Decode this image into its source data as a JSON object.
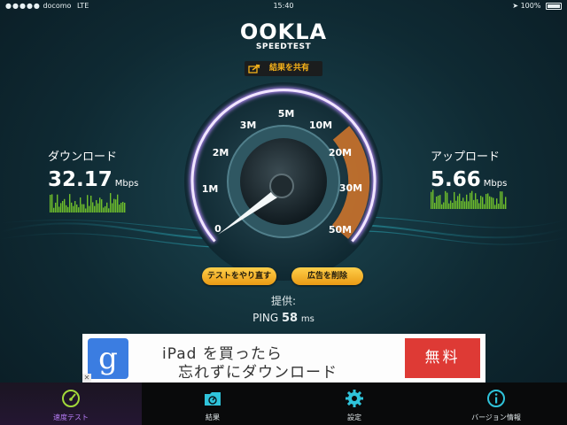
{
  "status_bar": {
    "carrier": "docomo",
    "network": "LTE",
    "time": "15:40",
    "battery": "100%"
  },
  "header": {
    "logo_text": "OOKLA",
    "logo_subtitle": "SPEEDTEST",
    "share_label": "結果を共有"
  },
  "download": {
    "label": "ダウンロード",
    "value": "32.17",
    "unit": "Mbps"
  },
  "upload": {
    "label": "アップロード",
    "value": "5.66",
    "unit": "Mbps"
  },
  "gauge": {
    "ticks": [
      "0",
      "1M",
      "2M",
      "3M",
      "5M",
      "10M",
      "20M",
      "30M",
      "50M"
    ],
    "needle_value": "0",
    "highlight_range": [
      "20M",
      "50M"
    ],
    "accent_color": "#d07a34",
    "ring_color": "#8f52e6"
  },
  "actions": {
    "retest_label": "テストをやり直す",
    "remove_ads_label": "広告を削除"
  },
  "provided_by": "提供:",
  "ping": {
    "label": "PING",
    "value": "58",
    "unit": "ms"
  },
  "ad": {
    "logo_letter": "g",
    "line1": "iPad を買ったら",
    "line2": "忘れずにダウンロード",
    "cta": "無料",
    "close": "✕"
  },
  "tabs": [
    {
      "label": "速度テスト",
      "icon": "speedometer-icon",
      "active": true
    },
    {
      "label": "結果",
      "icon": "results-folder-icon",
      "active": false
    },
    {
      "label": "設定",
      "icon": "gear-icon",
      "active": false
    },
    {
      "label": "バージョン情報",
      "icon": "info-icon",
      "active": false
    }
  ],
  "colors": {
    "tab_active": "#b67cf5",
    "brand_yellow": "#f6b21a",
    "graph_green": "#6fbf2c",
    "cta_red": "#de3a35"
  }
}
